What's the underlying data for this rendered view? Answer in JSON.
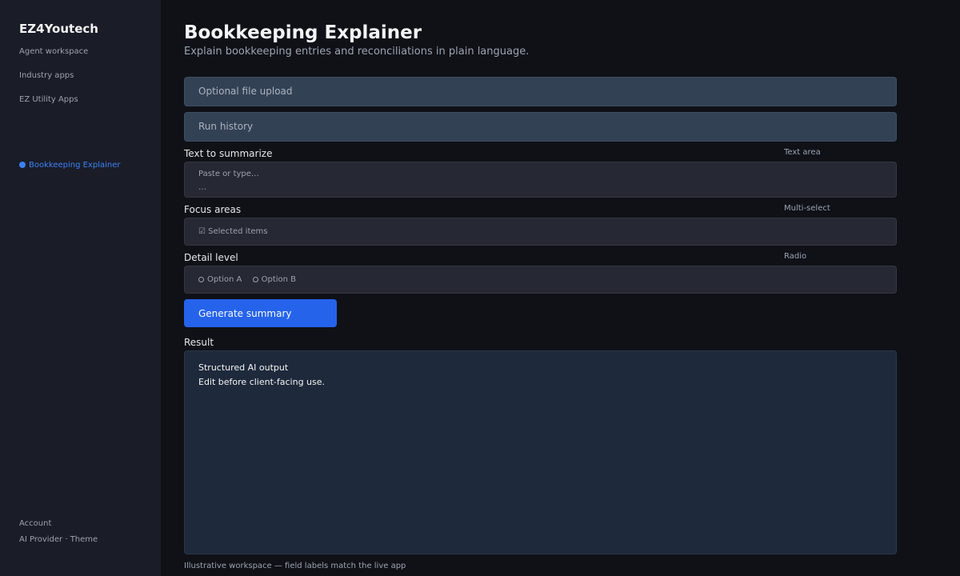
{
  "sidebar": {
    "brand": "EZ4Youtech",
    "items": [
      {
        "label": "Agent workspace"
      },
      {
        "label": "Industry apps"
      },
      {
        "label": "EZ Utility Apps"
      }
    ],
    "active_item": "Bookkeeping Explainer",
    "account": "Account",
    "ai_provider": "AI Provider",
    "separator": " · ",
    "theme": "Theme"
  },
  "page": {
    "title": "Bookkeeping Explainer",
    "subtitle": "Explain bookkeeping entries and reconciliations in plain language."
  },
  "sections": {
    "file_upload": "Optional file upload",
    "run_history": "Run history"
  },
  "fields": {
    "text": {
      "label": "Text to summarize",
      "type": "Text area",
      "placeholder": "Paste or type…",
      "ellipsis": "…"
    },
    "focus": {
      "label": "Focus areas",
      "type": "Multi-select",
      "value": "☑ Selected items"
    },
    "detail": {
      "label": "Detail level",
      "type": "Radio",
      "options": [
        "Option A",
        "Option B"
      ]
    }
  },
  "actions": {
    "generate": "Generate summary"
  },
  "result": {
    "label": "Result",
    "line1": "Structured AI output",
    "line2": "Edit before client-facing use."
  },
  "footer_note": "Illustrative workspace — field labels match the live app",
  "colors": {
    "accent": "#2563eb",
    "active_nav": "#3b82f6",
    "background": "#0f1117",
    "sidebar": "#1a1c27"
  }
}
